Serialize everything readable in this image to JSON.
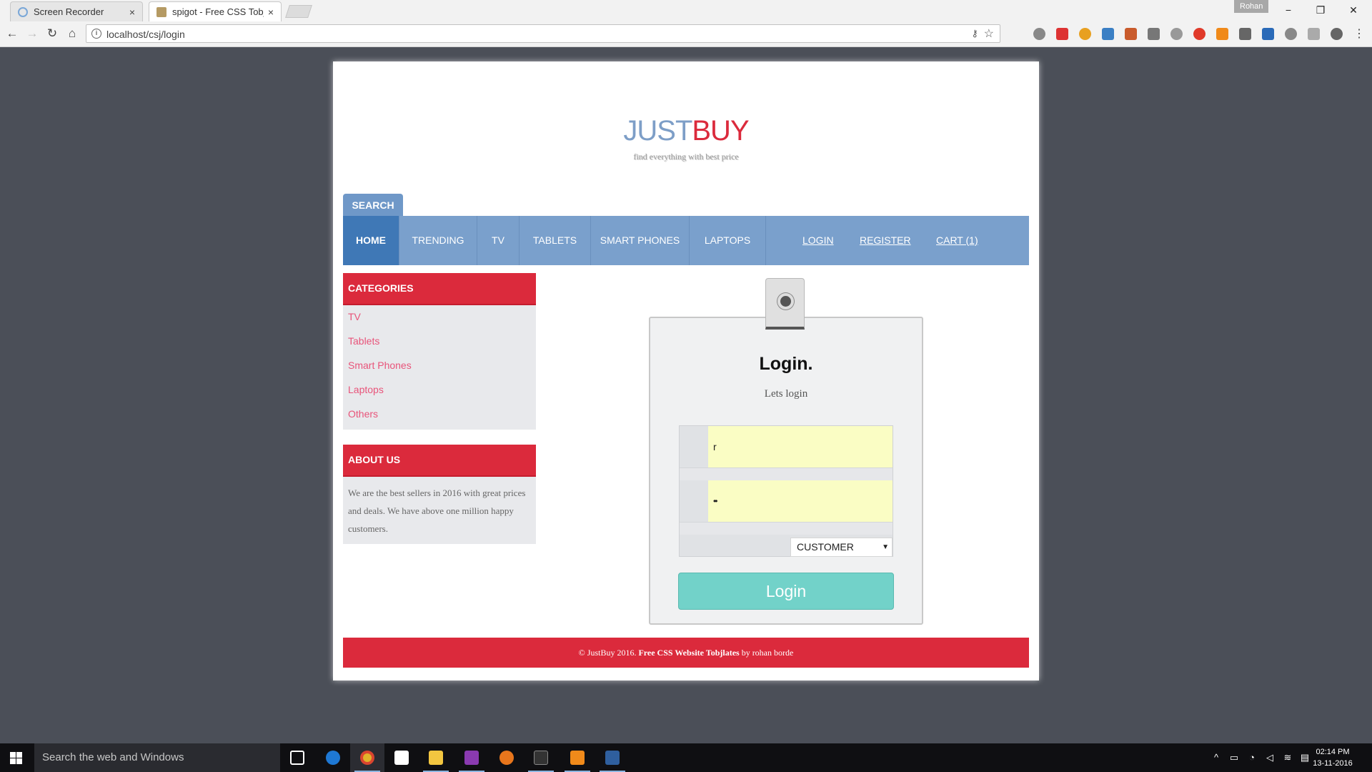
{
  "browser": {
    "tabs": [
      {
        "label": "Screen Recorder",
        "close": "×"
      },
      {
        "label": "spigot - Free CSS Tobjlates",
        "close": "×"
      }
    ],
    "profile_name": "Rohan",
    "url": "localhost/csj/login",
    "window_controls": {
      "minimize": "−",
      "maximize": "❐",
      "close": "✕"
    },
    "nav_glyphs": {
      "back": "←",
      "forward": "→",
      "reload": "↻",
      "home": "⌂",
      "star": "☆",
      "key": "⚷",
      "info": "i"
    }
  },
  "site": {
    "title_part1": "JUST",
    "title_part2": "BUY",
    "tagline": "find everything with best price",
    "search_label": "SEARCH",
    "nav": [
      "HOME",
      "TRENDING",
      "TV",
      "TABLETS",
      "SMART PHONES",
      "LAPTOPS"
    ],
    "nav_links": [
      "LOGIN",
      "REGISTER",
      "CART (1)"
    ],
    "categories_heading": "CATEGORIES",
    "categories": [
      "TV",
      "Tablets",
      "Smart Phones",
      "Laptops",
      "Others"
    ],
    "about_heading": "ABOUT US",
    "about_text": "We are the best sellers in 2016 with great prices and deals. We have above one million happy customers.",
    "footer_prefix": "© JustBuy 2016.",
    "footer_bold": "Free CSS Website Tobjlates",
    "footer_suffix": "by rohan borde"
  },
  "login": {
    "title": "Login.",
    "subtitle": "Lets login",
    "username_value": "r",
    "password_value": "••",
    "role_selected": "CUSTOMER",
    "button_label": "Login"
  },
  "taskbar": {
    "search_placeholder": "Search the web and Windows",
    "time": "02:14 PM",
    "date": "13-11-2016"
  },
  "colors": {
    "brand_blue": "#7d9ec7",
    "brand_red": "#db2a3c",
    "nav_bg": "#7aa0cc",
    "nav_active": "#3f78b6",
    "login_button": "#72d2c9",
    "input_bg": "#fafdc4"
  }
}
